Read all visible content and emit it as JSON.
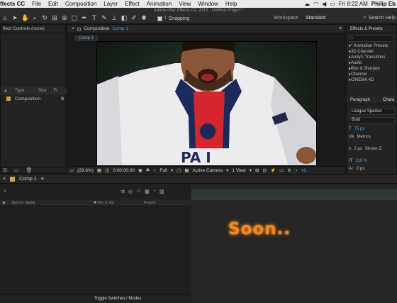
{
  "menubar": {
    "app": "ffects CC",
    "items": [
      "File",
      "Edit",
      "Composition",
      "Layer",
      "Effect",
      "Animation",
      "View",
      "Window",
      "Help"
    ],
    "time": "Fri 8:22 AM",
    "user": "Philip Eb"
  },
  "toolbar": {
    "window_title": "Adobe After Effects CC 2015 - Untitled Project *",
    "snapping_label": "Snapping",
    "workspace_label": "Workspace",
    "workspace_value": "Standard",
    "search_label": "Search Help"
  },
  "effect_controls": {
    "tab": "ffect Controls (none)"
  },
  "project": {
    "col_type": "Type",
    "col_size": "Size",
    "col_fr": "Fr",
    "item_name": "Composition"
  },
  "composition": {
    "tab_prefix": "Composition",
    "tab_name": "Comp 1",
    "sub_tab": "Comp 1",
    "zoom": "(29.6%)",
    "timecode": "0:00:00:00",
    "resolution": "Full",
    "camera": "Active Camera",
    "views": "1 View",
    "offset": "+0."
  },
  "effects_presets": {
    "title": "Effects & Presets",
    "search_placeholder": "",
    "items": [
      "* Animation Presets",
      "3D Channel",
      "Andy's Transitions",
      "Audio",
      "Blur & Sharpen",
      "Channel",
      "CINEMA 4D"
    ]
  },
  "character": {
    "tab_paragraph": "Paragraph",
    "tab_character": "Chara",
    "font": "League Spartan",
    "style": "Bold",
    "size": "75 px",
    "kerning": "Metrics",
    "stroke_width": "2 px",
    "stroke_mode": "Stroke O",
    "scale": "110 %",
    "baseline": "0 px"
  },
  "timeline": {
    "tab": "Comp 1",
    "col_source": "Source Name",
    "col_parent": "Parent",
    "overlay_text": "Soon..",
    "footer": "Toggle Switches / Modes"
  }
}
